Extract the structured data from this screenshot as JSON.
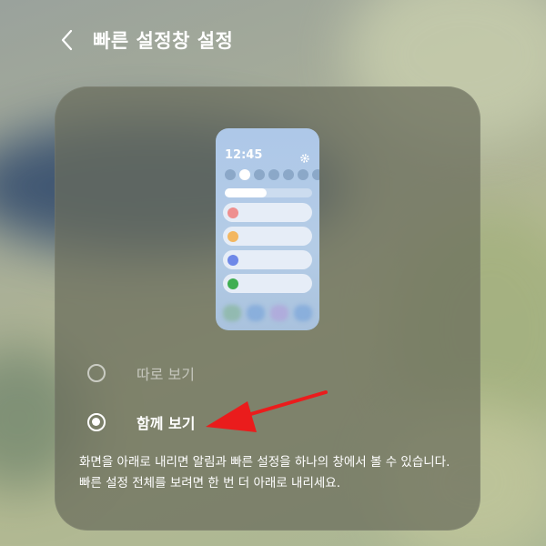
{
  "header": {
    "back_icon": "chevron-left-icon",
    "title": "빠른 설정창 설정"
  },
  "preview": {
    "time": "12:45",
    "gear_icon": "gear-icon",
    "brightness_level": 0.48,
    "notification_colors": [
      "#ee8f8f",
      "#f3b761",
      "#6e88e8",
      "#3fae52"
    ],
    "bottom_colors": [
      "#7fb38b",
      "#6f9ed9",
      "#b39ad9",
      "#6f9ed9"
    ]
  },
  "options": [
    {
      "label": "따로 보기",
      "selected": false
    },
    {
      "label": "함께 보기",
      "selected": true
    }
  ],
  "description": "화면을 아래로 내리면 알림과 빠른 설정을 하나의 창에서 볼 수 있습니다. 빠른 설정 전체를 보려면 한 번 더 아래로 내리세요.",
  "colors": {
    "annotation_arrow": "#ea1c1c",
    "accent_text": "#ffffff"
  }
}
